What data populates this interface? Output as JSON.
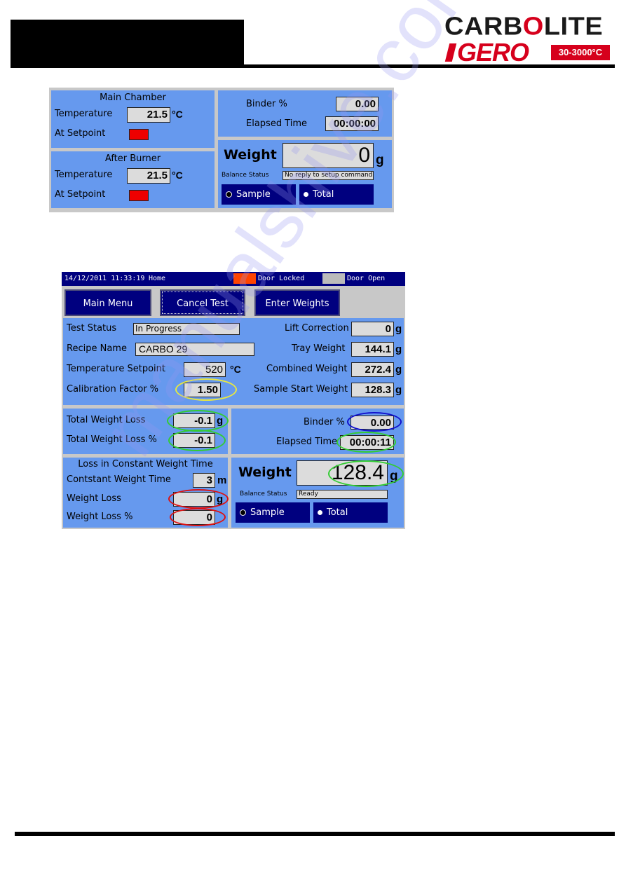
{
  "document": {
    "header_block": "",
    "logo": {
      "brand_top": "CARB",
      "brand_o": "O",
      "brand_tail": "LITE",
      "brand_bottom": "GERO",
      "temperature_range": "30-3000°C",
      "brand_color": "#d6001c"
    },
    "watermark": "manualshive.com"
  },
  "panel1": {
    "main_chamber": {
      "title": "Main Chamber",
      "temperature_label": "Temperature",
      "temperature_value": "21.5",
      "temperature_unit": "°C",
      "at_setpoint_label": "At Setpoint",
      "at_setpoint_color": "#ee0000"
    },
    "after_burner": {
      "title": "After Burner",
      "temperature_label": "Temperature",
      "temperature_value": "21.5",
      "temperature_unit": "°C",
      "at_setpoint_label": "At Setpoint",
      "at_setpoint_color": "#ee0000"
    },
    "binder_label": "Binder %",
    "binder_value": "0.00",
    "elapsed_label": "Elapsed Time",
    "elapsed_value": "00:00:00",
    "weight_label": "Weight",
    "weight_value": "0",
    "weight_unit": "g",
    "balance_status_label": "Balance Status",
    "balance_status_value": "No reply to setup command",
    "sample_button": "Sample",
    "total_button": "Total"
  },
  "panel2": {
    "status_bar": {
      "datetime": "14/12/2011 11:33:19",
      "screen": "Home",
      "door_locked_label": "Door Locked",
      "door_locked_color": "#ff4400",
      "door_open_label": "Door Open",
      "door_open_color": "#bbbbbb"
    },
    "nav": {
      "main_menu": "Main Menu",
      "cancel_test": "Cancel Test",
      "enter_weights": "Enter Weights"
    },
    "info": {
      "test_status_label": "Test Status",
      "test_status_value": "In Progress",
      "recipe_name_label": "Recipe Name",
      "recipe_name_value": "CARBO 29",
      "temp_setpoint_label": "Temperature Setpoint",
      "temp_setpoint_value": "520",
      "temp_setpoint_unit": "°C",
      "calibration_label": "Calibration Factor %",
      "calibration_value": "1.50",
      "lift_correction_label": "Lift Correction",
      "lift_correction_value": "0",
      "tray_weight_label": "Tray Weight",
      "tray_weight_value": "144.1",
      "combined_weight_label": "Combined Weight",
      "combined_weight_value": "272.4",
      "sample_start_label": "Sample Start Weight",
      "sample_start_value": "128.3",
      "unit_g": "g"
    },
    "loss": {
      "total_weight_loss_label": "Total Weight Loss",
      "total_weight_loss_value": "-0.1",
      "total_weight_loss_pct_label": "Total Weight Loss %",
      "total_weight_loss_pct_value": "-0.1",
      "unit_g": "g"
    },
    "constant": {
      "title": "Loss in Constant Weight Time",
      "time_label": "Contstant Weight Time",
      "time_value": "3",
      "time_unit": "m",
      "weight_loss_label": "Weight Loss",
      "weight_loss_value": "0",
      "weight_loss_unit": "g",
      "weight_loss_pct_label": "Weight Loss %",
      "weight_loss_pct_value": "0"
    },
    "binder_label": "Binder %",
    "binder_value": "0.00",
    "elapsed_label": "Elapsed Time",
    "elapsed_value": "00:00:11",
    "weight_label": "Weight",
    "weight_value": "128.4",
    "weight_unit": "g",
    "balance_status_label": "Balance Status",
    "balance_status_value": "Ready",
    "sample_button": "Sample",
    "total_button": "Total"
  }
}
